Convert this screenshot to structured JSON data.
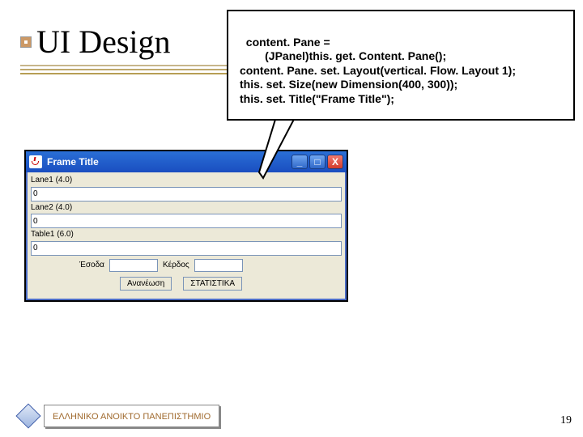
{
  "title": "UI Design",
  "code": "content. Pane =\n        (JPanel)this. get. Content. Pane();\ncontent. Pane. set. Layout(vertical. Flow. Layout 1);\nthis. set. Size(new Dimension(400, 300));\nthis. set. Title(\"Frame Title\");",
  "frame": {
    "title": "Frame Title",
    "labels": {
      "lane1": "Lane1 (4.0)",
      "lane2": "Lane2 (4.0)",
      "table1": "Table1 (6.0)"
    },
    "values": {
      "lane1": "0",
      "lane2": "0",
      "table1": "0"
    },
    "income_label": "Έσοδα",
    "expense_label": "Κέρδος",
    "refresh": "Ανανέωση",
    "stats": "ΣΤΑΤΙΣΤΙΚΑ",
    "win": {
      "min": "_",
      "max": "□",
      "close": "X"
    }
  },
  "footer": "ΕΛΛΗΝΙΚΟ ΑΝΟΙΚΤΟ ΠΑΝΕΠΙΣΤΗΜΙΟ",
  "slide_number": "19"
}
